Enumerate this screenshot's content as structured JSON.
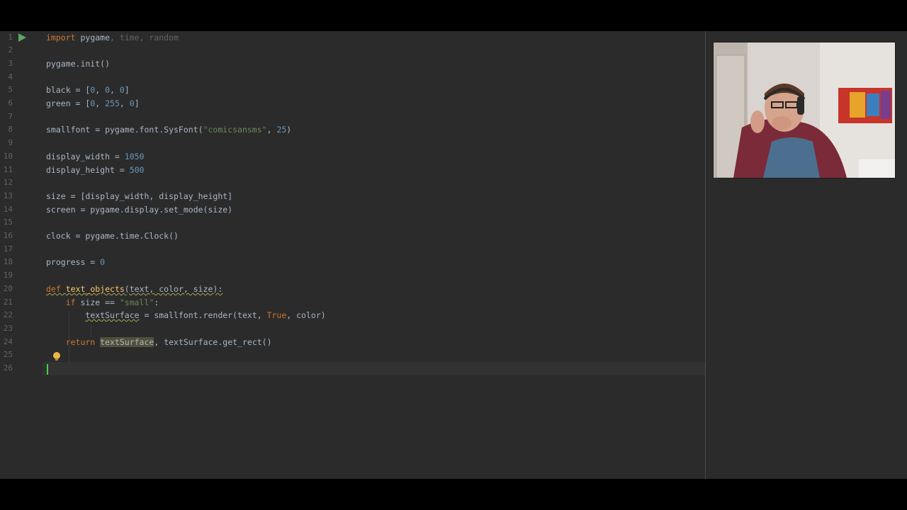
{
  "editor": {
    "lines": [
      {
        "n": "1",
        "tokens": [
          {
            "t": "import ",
            "c": "t-kw"
          },
          {
            "t": "pygame",
            "c": "t-id"
          },
          {
            "t": ", time, random",
            "c": "t-dim"
          }
        ]
      },
      {
        "n": "2",
        "tokens": []
      },
      {
        "n": "3",
        "tokens": [
          {
            "t": "pygame.init()",
            "c": "t-id"
          }
        ]
      },
      {
        "n": "4",
        "tokens": []
      },
      {
        "n": "5",
        "tokens": [
          {
            "t": "black = [",
            "c": "t-id"
          },
          {
            "t": "0",
            "c": "t-num"
          },
          {
            "t": ", ",
            "c": "t-id"
          },
          {
            "t": "0",
            "c": "t-num"
          },
          {
            "t": ", ",
            "c": "t-id"
          },
          {
            "t": "0",
            "c": "t-num"
          },
          {
            "t": "]",
            "c": "t-id"
          }
        ]
      },
      {
        "n": "6",
        "tokens": [
          {
            "t": "green = [",
            "c": "t-id"
          },
          {
            "t": "0",
            "c": "t-num"
          },
          {
            "t": ", ",
            "c": "t-id"
          },
          {
            "t": "255",
            "c": "t-num"
          },
          {
            "t": ", ",
            "c": "t-id"
          },
          {
            "t": "0",
            "c": "t-num"
          },
          {
            "t": "]",
            "c": "t-id"
          }
        ]
      },
      {
        "n": "7",
        "tokens": []
      },
      {
        "n": "8",
        "tokens": [
          {
            "t": "smallfont = pygame.font.SysFont(",
            "c": "t-id"
          },
          {
            "t": "\"comicsansms\"",
            "c": "t-str"
          },
          {
            "t": ", ",
            "c": "t-id"
          },
          {
            "t": "25",
            "c": "t-num"
          },
          {
            "t": ")",
            "c": "t-id"
          }
        ]
      },
      {
        "n": "9",
        "tokens": []
      },
      {
        "n": "10",
        "tokens": [
          {
            "t": "display_width = ",
            "c": "t-id"
          },
          {
            "t": "1050",
            "c": "t-num"
          }
        ]
      },
      {
        "n": "11",
        "tokens": [
          {
            "t": "display_height = ",
            "c": "t-id"
          },
          {
            "t": "500",
            "c": "t-num"
          }
        ]
      },
      {
        "n": "12",
        "tokens": []
      },
      {
        "n": "13",
        "tokens": [
          {
            "t": "size = [display_width, display_height]",
            "c": "t-id"
          }
        ]
      },
      {
        "n": "14",
        "tokens": [
          {
            "t": "screen = pygame.display.set_mode(size)",
            "c": "t-id"
          }
        ]
      },
      {
        "n": "15",
        "tokens": []
      },
      {
        "n": "16",
        "tokens": [
          {
            "t": "clock = pygame.time.Clock()",
            "c": "t-id"
          }
        ]
      },
      {
        "n": "17",
        "tokens": []
      },
      {
        "n": "18",
        "tokens": [
          {
            "t": "progress = ",
            "c": "t-id"
          },
          {
            "t": "0",
            "c": "t-num"
          }
        ]
      },
      {
        "n": "19",
        "tokens": []
      },
      {
        "n": "20",
        "tokens": [
          {
            "t": "def ",
            "c": "t-kw squiggle-warn"
          },
          {
            "t": "text_objects",
            "c": "t-fn squiggle-warn"
          },
          {
            "t": "(text, color, size):",
            "c": "t-id squiggle-warn"
          }
        ]
      },
      {
        "n": "21",
        "tokens": [
          {
            "t": "    if ",
            "c": "t-kw"
          },
          {
            "t": "size == ",
            "c": "t-id"
          },
          {
            "t": "\"small\"",
            "c": "t-str"
          },
          {
            "t": ":",
            "c": "t-id"
          }
        ]
      },
      {
        "n": "22",
        "tokens": [
          {
            "t": "        ",
            "c": "t-id"
          },
          {
            "t": "textSurface",
            "c": "t-id squiggle-warn"
          },
          {
            "t": " = smallfont.render(text, ",
            "c": "t-id"
          },
          {
            "t": "True",
            "c": "t-kw"
          },
          {
            "t": ", color)",
            "c": "t-id"
          }
        ]
      },
      {
        "n": "23",
        "tokens": []
      },
      {
        "n": "24",
        "tokens": [
          {
            "t": "    return ",
            "c": "t-kw"
          },
          {
            "t": "textSurface",
            "c": "t-id hl-usage"
          },
          {
            "t": ", textSurface.get_rect()",
            "c": "t-id"
          }
        ]
      },
      {
        "n": "25",
        "tokens": []
      },
      {
        "n": "26",
        "tokens": []
      }
    ],
    "icons": {
      "run": "run-triangle-icon",
      "intention": "lightbulb-icon"
    },
    "colors": {
      "background": "#2b2b2b",
      "keyword": "#cc7832",
      "number": "#6897bb",
      "string": "#6a8759",
      "caret": "#3fd63f"
    }
  },
  "webcam": {
    "description": "presenter-video-feed"
  }
}
